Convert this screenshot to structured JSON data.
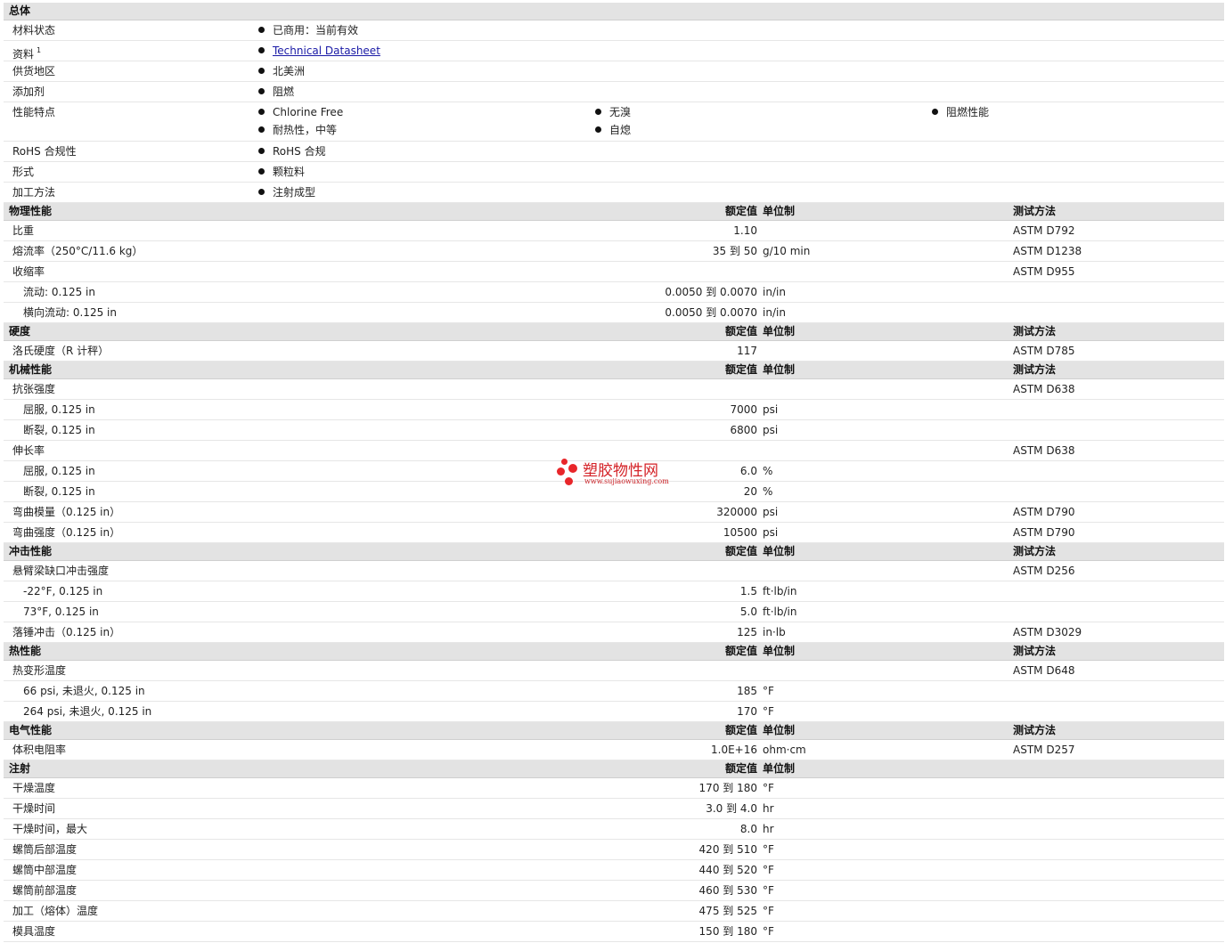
{
  "general": {
    "title": "总体",
    "rows": [
      {
        "label": "材料状态",
        "items": [
          "已商用：当前有效"
        ]
      },
      {
        "label": "资料",
        "sup": "1",
        "link": "Technical Datasheet"
      },
      {
        "label": "供货地区",
        "items": [
          "北美洲"
        ]
      },
      {
        "label": "添加剂",
        "items": [
          "阻燃"
        ]
      }
    ],
    "features": {
      "label": "性能特点",
      "col1": [
        "Chlorine Free",
        "耐热性，中等"
      ],
      "col2": [
        "无溴",
        "自熄"
      ],
      "col3": [
        "阻燃性能"
      ]
    },
    "rows2": [
      {
        "label": "RoHS 合规性",
        "items": [
          "RoHS 合规"
        ]
      },
      {
        "label": "形式",
        "items": [
          "颗粒料"
        ]
      },
      {
        "label": "加工方法",
        "items": [
          "注射成型"
        ]
      }
    ]
  },
  "headers": {
    "value": "额定值",
    "unit": "单位制",
    "test": "测试方法"
  },
  "sections": [
    {
      "title": "物理性能",
      "has_test": true,
      "rows": [
        {
          "label": "比重",
          "value": "1.10",
          "unit": "",
          "test": "ASTM D792"
        },
        {
          "label": "熔流率（250°C/11.6 kg）",
          "value": "35 到  50",
          "unit": "g/10 min",
          "test": "ASTM D1238"
        },
        {
          "label": "收缩率",
          "value": "",
          "unit": "",
          "test": "ASTM D955"
        },
        {
          "label": "流动: 0.125 in",
          "sub": true,
          "value": "0.0050 到  0.0070",
          "unit": "in/in",
          "test": ""
        },
        {
          "label": "横向流动: 0.125 in",
          "sub": true,
          "value": "0.0050 到  0.0070",
          "unit": "in/in",
          "test": ""
        }
      ]
    },
    {
      "title": "硬度",
      "has_test": true,
      "rows": [
        {
          "label": "洛氏硬度（R 计秤）",
          "value": "117",
          "unit": "",
          "test": "ASTM D785"
        }
      ]
    },
    {
      "title": "机械性能",
      "has_test": true,
      "rows": [
        {
          "label": "抗张强度",
          "value": "",
          "unit": "",
          "test": "ASTM D638"
        },
        {
          "label": "屈服, 0.125 in",
          "sub": true,
          "value": "7000",
          "unit": "psi",
          "test": ""
        },
        {
          "label": "断裂, 0.125 in",
          "sub": true,
          "value": "6800",
          "unit": "psi",
          "test": ""
        },
        {
          "label": "伸长率",
          "value": "",
          "unit": "",
          "test": "ASTM D638"
        },
        {
          "label": "屈服, 0.125 in",
          "sub": true,
          "value": "6.0",
          "unit": "%",
          "test": ""
        },
        {
          "label": "断裂, 0.125 in",
          "sub": true,
          "value": "20",
          "unit": "%",
          "test": ""
        },
        {
          "label": "弯曲模量（0.125 in）",
          "value": "320000",
          "unit": "psi",
          "test": "ASTM D790"
        },
        {
          "label": "弯曲强度（0.125 in）",
          "value": "10500",
          "unit": "psi",
          "test": "ASTM D790"
        }
      ]
    },
    {
      "title": "冲击性能",
      "has_test": true,
      "rows": [
        {
          "label": "悬臂梁缺口冲击强度",
          "value": "",
          "unit": "",
          "test": "ASTM D256"
        },
        {
          "label": "-22°F, 0.125 in",
          "sub": true,
          "value": "1.5",
          "unit": "ft·lb/in",
          "test": ""
        },
        {
          "label": "73°F, 0.125 in",
          "sub": true,
          "value": "5.0",
          "unit": "ft·lb/in",
          "test": ""
        },
        {
          "label": "落锤冲击（0.125 in）",
          "value": "125",
          "unit": "in·lb",
          "test": "ASTM D3029"
        }
      ]
    },
    {
      "title": "热性能",
      "has_test": true,
      "rows": [
        {
          "label": "热变形温度",
          "value": "",
          "unit": "",
          "test": "ASTM D648"
        },
        {
          "label": "66 psi, 未退火, 0.125 in",
          "sub": true,
          "value": "185",
          "unit": "°F",
          "test": ""
        },
        {
          "label": "264 psi, 未退火, 0.125 in",
          "sub": true,
          "value": "170",
          "unit": "°F",
          "test": ""
        }
      ]
    },
    {
      "title": "电气性能",
      "has_test": true,
      "rows": [
        {
          "label": "体积电阻率",
          "value": "1.0E+16",
          "unit": "ohm·cm",
          "test": "ASTM D257"
        }
      ]
    },
    {
      "title": "注射",
      "has_test": false,
      "rows": [
        {
          "label": "干燥温度",
          "value": "170 到  180",
          "unit": "°F",
          "test": ""
        },
        {
          "label": "干燥时间",
          "value": "3.0 到  4.0",
          "unit": "hr",
          "test": ""
        },
        {
          "label": "干燥时间，最大",
          "value": "8.0",
          "unit": "hr",
          "test": ""
        },
        {
          "label": "螺筒后部温度",
          "value": "420 到  510",
          "unit": "°F",
          "test": ""
        },
        {
          "label": "螺筒中部温度",
          "value": "440 到  520",
          "unit": "°F",
          "test": ""
        },
        {
          "label": "螺筒前部温度",
          "value": "460 到  530",
          "unit": "°F",
          "test": ""
        },
        {
          "label": "加工（熔体）温度",
          "value": "475 到  525",
          "unit": "°F",
          "test": ""
        },
        {
          "label": "模具温度",
          "value": "150 到  180",
          "unit": "°F",
          "test": ""
        }
      ]
    }
  ],
  "watermark": {
    "name": "塑胶物性网",
    "url": "www.sujiaowuxing.com"
  }
}
